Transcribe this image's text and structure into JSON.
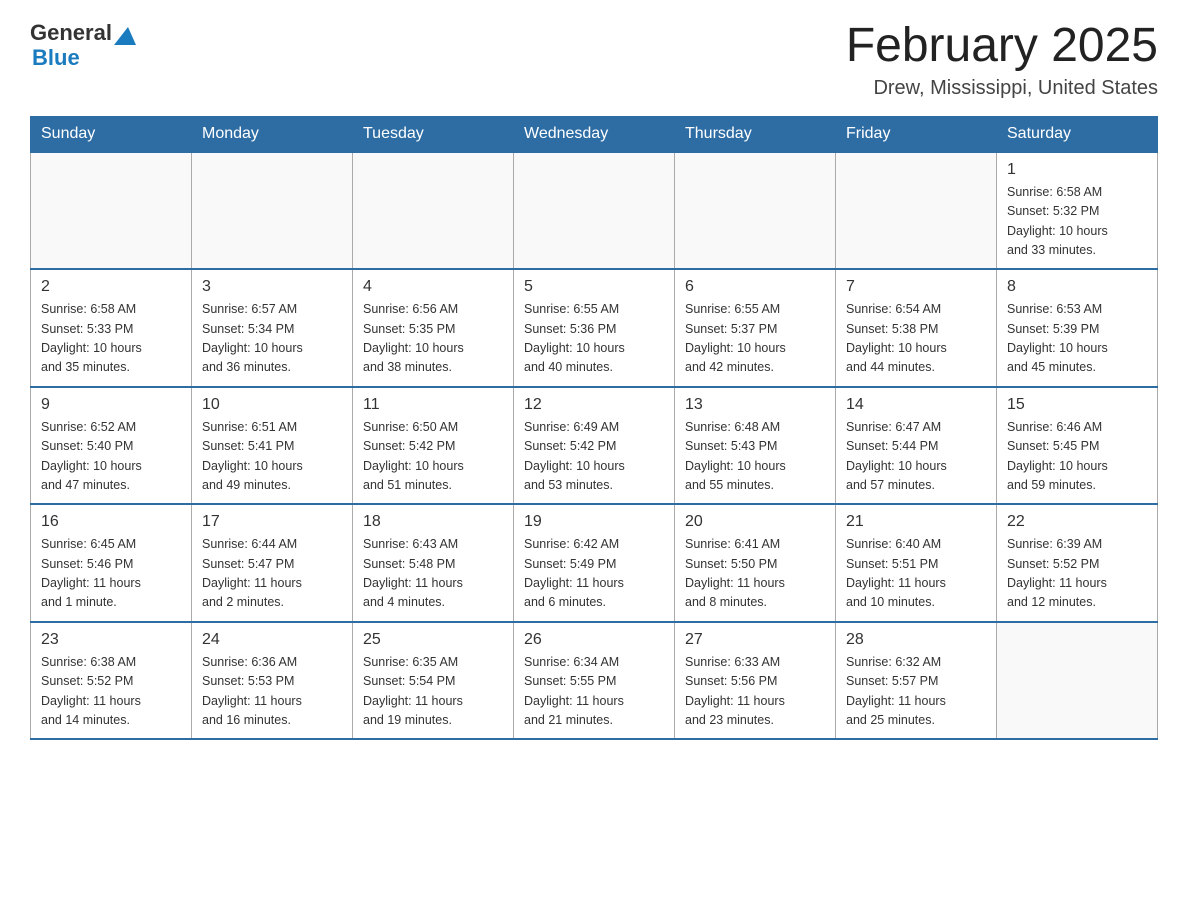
{
  "logo": {
    "text_general": "General",
    "text_blue": "Blue"
  },
  "title": "February 2025",
  "location": "Drew, Mississippi, United States",
  "days_of_week": [
    "Sunday",
    "Monday",
    "Tuesday",
    "Wednesday",
    "Thursday",
    "Friday",
    "Saturday"
  ],
  "weeks": [
    [
      {
        "day": "",
        "info": ""
      },
      {
        "day": "",
        "info": ""
      },
      {
        "day": "",
        "info": ""
      },
      {
        "day": "",
        "info": ""
      },
      {
        "day": "",
        "info": ""
      },
      {
        "day": "",
        "info": ""
      },
      {
        "day": "1",
        "info": "Sunrise: 6:58 AM\nSunset: 5:32 PM\nDaylight: 10 hours\nand 33 minutes."
      }
    ],
    [
      {
        "day": "2",
        "info": "Sunrise: 6:58 AM\nSunset: 5:33 PM\nDaylight: 10 hours\nand 35 minutes."
      },
      {
        "day": "3",
        "info": "Sunrise: 6:57 AM\nSunset: 5:34 PM\nDaylight: 10 hours\nand 36 minutes."
      },
      {
        "day": "4",
        "info": "Sunrise: 6:56 AM\nSunset: 5:35 PM\nDaylight: 10 hours\nand 38 minutes."
      },
      {
        "day": "5",
        "info": "Sunrise: 6:55 AM\nSunset: 5:36 PM\nDaylight: 10 hours\nand 40 minutes."
      },
      {
        "day": "6",
        "info": "Sunrise: 6:55 AM\nSunset: 5:37 PM\nDaylight: 10 hours\nand 42 minutes."
      },
      {
        "day": "7",
        "info": "Sunrise: 6:54 AM\nSunset: 5:38 PM\nDaylight: 10 hours\nand 44 minutes."
      },
      {
        "day": "8",
        "info": "Sunrise: 6:53 AM\nSunset: 5:39 PM\nDaylight: 10 hours\nand 45 minutes."
      }
    ],
    [
      {
        "day": "9",
        "info": "Sunrise: 6:52 AM\nSunset: 5:40 PM\nDaylight: 10 hours\nand 47 minutes."
      },
      {
        "day": "10",
        "info": "Sunrise: 6:51 AM\nSunset: 5:41 PM\nDaylight: 10 hours\nand 49 minutes."
      },
      {
        "day": "11",
        "info": "Sunrise: 6:50 AM\nSunset: 5:42 PM\nDaylight: 10 hours\nand 51 minutes."
      },
      {
        "day": "12",
        "info": "Sunrise: 6:49 AM\nSunset: 5:42 PM\nDaylight: 10 hours\nand 53 minutes."
      },
      {
        "day": "13",
        "info": "Sunrise: 6:48 AM\nSunset: 5:43 PM\nDaylight: 10 hours\nand 55 minutes."
      },
      {
        "day": "14",
        "info": "Sunrise: 6:47 AM\nSunset: 5:44 PM\nDaylight: 10 hours\nand 57 minutes."
      },
      {
        "day": "15",
        "info": "Sunrise: 6:46 AM\nSunset: 5:45 PM\nDaylight: 10 hours\nand 59 minutes."
      }
    ],
    [
      {
        "day": "16",
        "info": "Sunrise: 6:45 AM\nSunset: 5:46 PM\nDaylight: 11 hours\nand 1 minute."
      },
      {
        "day": "17",
        "info": "Sunrise: 6:44 AM\nSunset: 5:47 PM\nDaylight: 11 hours\nand 2 minutes."
      },
      {
        "day": "18",
        "info": "Sunrise: 6:43 AM\nSunset: 5:48 PM\nDaylight: 11 hours\nand 4 minutes."
      },
      {
        "day": "19",
        "info": "Sunrise: 6:42 AM\nSunset: 5:49 PM\nDaylight: 11 hours\nand 6 minutes."
      },
      {
        "day": "20",
        "info": "Sunrise: 6:41 AM\nSunset: 5:50 PM\nDaylight: 11 hours\nand 8 minutes."
      },
      {
        "day": "21",
        "info": "Sunrise: 6:40 AM\nSunset: 5:51 PM\nDaylight: 11 hours\nand 10 minutes."
      },
      {
        "day": "22",
        "info": "Sunrise: 6:39 AM\nSunset: 5:52 PM\nDaylight: 11 hours\nand 12 minutes."
      }
    ],
    [
      {
        "day": "23",
        "info": "Sunrise: 6:38 AM\nSunset: 5:52 PM\nDaylight: 11 hours\nand 14 minutes."
      },
      {
        "day": "24",
        "info": "Sunrise: 6:36 AM\nSunset: 5:53 PM\nDaylight: 11 hours\nand 16 minutes."
      },
      {
        "day": "25",
        "info": "Sunrise: 6:35 AM\nSunset: 5:54 PM\nDaylight: 11 hours\nand 19 minutes."
      },
      {
        "day": "26",
        "info": "Sunrise: 6:34 AM\nSunset: 5:55 PM\nDaylight: 11 hours\nand 21 minutes."
      },
      {
        "day": "27",
        "info": "Sunrise: 6:33 AM\nSunset: 5:56 PM\nDaylight: 11 hours\nand 23 minutes."
      },
      {
        "day": "28",
        "info": "Sunrise: 6:32 AM\nSunset: 5:57 PM\nDaylight: 11 hours\nand 25 minutes."
      },
      {
        "day": "",
        "info": ""
      }
    ]
  ]
}
